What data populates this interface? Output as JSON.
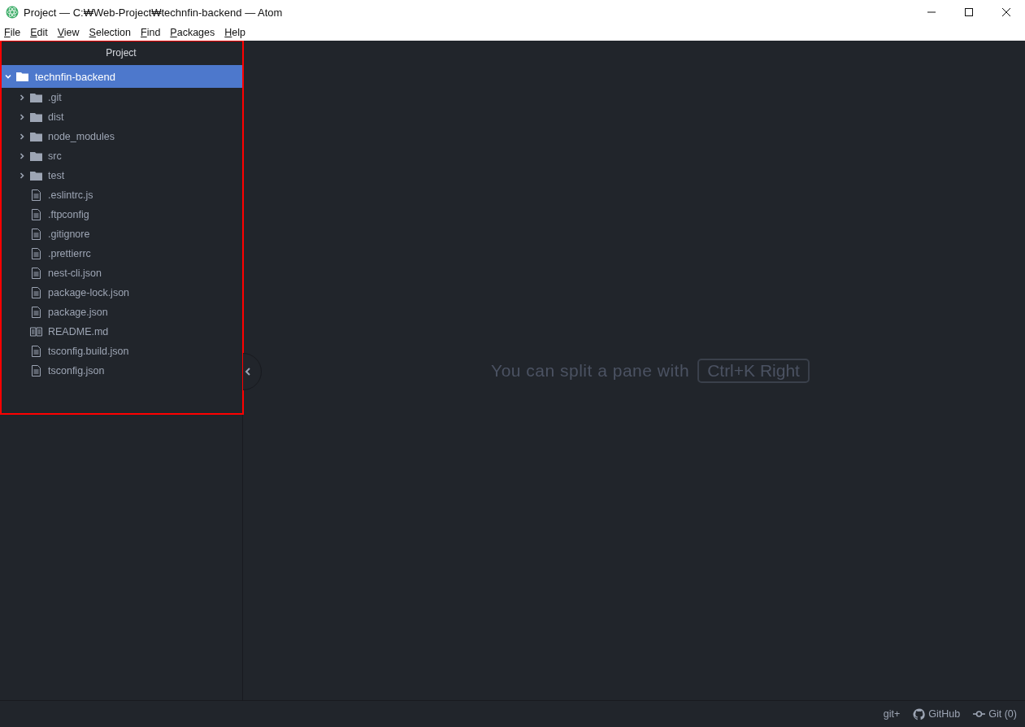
{
  "window": {
    "title": "Project — C:₩Web-Project₩technfin-backend — Atom"
  },
  "menu": [
    "File",
    "Edit",
    "View",
    "Selection",
    "Find",
    "Packages",
    "Help"
  ],
  "tree_view": {
    "title": "Project",
    "root": {
      "name": "technfin-backend",
      "expanded": true,
      "selected": true,
      "children": [
        {
          "kind": "folder",
          "name": ".git",
          "expanded": false
        },
        {
          "kind": "folder",
          "name": "dist",
          "expanded": false
        },
        {
          "kind": "folder",
          "name": "node_modules",
          "expanded": false
        },
        {
          "kind": "folder",
          "name": "src",
          "expanded": false
        },
        {
          "kind": "folder",
          "name": "test",
          "expanded": false
        },
        {
          "kind": "file",
          "name": ".eslintrc.js"
        },
        {
          "kind": "file",
          "name": ".ftpconfig"
        },
        {
          "kind": "file",
          "name": ".gitignore"
        },
        {
          "kind": "file",
          "name": ".prettierrc"
        },
        {
          "kind": "file",
          "name": "nest-cli.json"
        },
        {
          "kind": "file",
          "name": "package-lock.json"
        },
        {
          "kind": "file",
          "name": "package.json"
        },
        {
          "kind": "readme",
          "name": "README.md"
        },
        {
          "kind": "file",
          "name": "tsconfig.build.json"
        },
        {
          "kind": "file",
          "name": "tsconfig.json"
        }
      ]
    }
  },
  "editor": {
    "hint": "You can split a pane with",
    "shortcut": "Ctrl+K Right"
  },
  "status_bar": {
    "items": [
      {
        "kind": "text",
        "label": "git+"
      },
      {
        "kind": "github",
        "label": "GitHub"
      },
      {
        "kind": "git",
        "label": "Git (0)"
      }
    ]
  }
}
